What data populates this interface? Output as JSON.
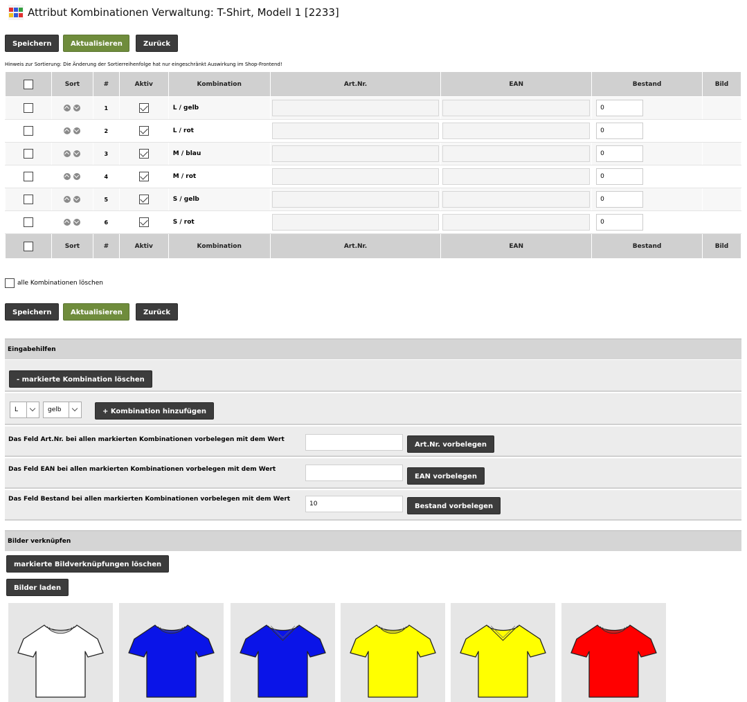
{
  "page": {
    "title": "Attribut Kombinationen Verwaltung: T-Shirt, Modell 1 [2233]"
  },
  "buttons": {
    "save": "Speichern",
    "refresh": "Aktualisieren",
    "back": "Zurück"
  },
  "hint": "Hinweis zur Sortierung: Die Änderung der Sortierreihenfolge hat nur eingeschränkt Auswirkung im Shop-Frontend!",
  "table": {
    "headers": {
      "sort": "Sort",
      "num": "#",
      "active": "Aktiv",
      "combination": "Kombination",
      "artnr": "Art.Nr.",
      "ean": "EAN",
      "stock": "Bestand",
      "image": "Bild"
    },
    "rows": [
      {
        "num": "1",
        "combination": "L / gelb",
        "stock": "0"
      },
      {
        "num": "2",
        "combination": "L / rot",
        "stock": "0"
      },
      {
        "num": "3",
        "combination": "M / blau",
        "stock": "0"
      },
      {
        "num": "4",
        "combination": "M / rot",
        "stock": "0"
      },
      {
        "num": "5",
        "combination": "S / gelb",
        "stock": "0"
      },
      {
        "num": "6",
        "combination": "S / rot",
        "stock": "0"
      }
    ]
  },
  "delete_all_label": "alle Kombinationen löschen",
  "helpers": {
    "title": "Eingabehilfen",
    "delete_marked": "- markierte Kombination löschen",
    "size_value": "L",
    "color_value": "gelb",
    "add_combination": "+ Kombination hinzufügen",
    "prefill": [
      {
        "label": "Das Feld Art.Nr. bei allen markierten Kombinationen vorbelegen mit dem Wert",
        "value": "",
        "button": "Art.Nr. vorbelegen"
      },
      {
        "label": "Das Feld EAN bei allen markierten Kombinationen vorbelegen mit dem Wert",
        "value": "",
        "button": "EAN vorbelegen"
      },
      {
        "label": "Das Feld Bestand bei allen markierten Kombinationen vorbelegen mit dem Wert",
        "value": "10",
        "button": "Bestand vorbelegen"
      }
    ]
  },
  "images": {
    "title": "Bilder verknüpfen",
    "delete_links": "markierte Bildverknüpfungen löschen",
    "load": "Bilder laden",
    "thumbnails": [
      {
        "color": "#ffffff",
        "neck": "round"
      },
      {
        "color": "#0a14e8",
        "neck": "round"
      },
      {
        "color": "#0a14e8",
        "neck": "v"
      },
      {
        "color": "#ffff00",
        "neck": "round"
      },
      {
        "color": "#ffff00",
        "neck": "v"
      },
      {
        "color": "#ff0000",
        "neck": "round"
      }
    ]
  }
}
